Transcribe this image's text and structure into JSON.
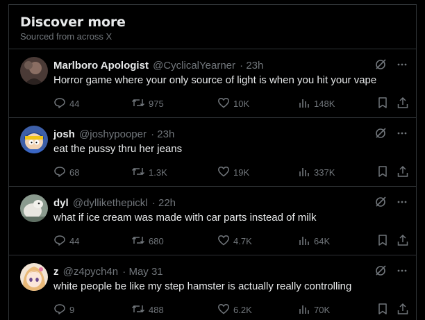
{
  "section": {
    "title": "Discover more",
    "subtitle": "Sourced from across X"
  },
  "icons": {
    "grok": "grok-slash-circle-icon",
    "more": "more-dots-icon",
    "reply": "reply-bubble-icon",
    "repost": "repost-arrows-icon",
    "like": "heart-icon",
    "views": "views-bars-icon",
    "bookmark": "bookmark-icon",
    "share": "share-upload-icon"
  },
  "tweets": [
    {
      "name": "Marlboro Apologist",
      "handle": "@CyclicalYearner",
      "time": "· 23h",
      "text": "Horror game where your only source of light is when you hit your vape",
      "replies": "44",
      "reposts": "975",
      "likes": "10K",
      "views": "148K"
    },
    {
      "name": "josh",
      "handle": "@joshypooper",
      "time": "· 23h",
      "text": "eat the pussy thru her jeans",
      "replies": "68",
      "reposts": "1.3K",
      "likes": "19K",
      "views": "337K"
    },
    {
      "name": "dyl",
      "handle": "@dyllikethepickl",
      "time": "· 22h",
      "text": "what if ice cream was made with car parts instead of milk",
      "replies": "44",
      "reposts": "680",
      "likes": "4.7K",
      "views": "64K"
    },
    {
      "name": "z",
      "handle": "@z4pych4n",
      "time": "· May 31",
      "text": "white people be like my step hamster is actually really controlling",
      "replies": "9",
      "reposts": "488",
      "likes": "6.2K",
      "views": "70K"
    }
  ]
}
